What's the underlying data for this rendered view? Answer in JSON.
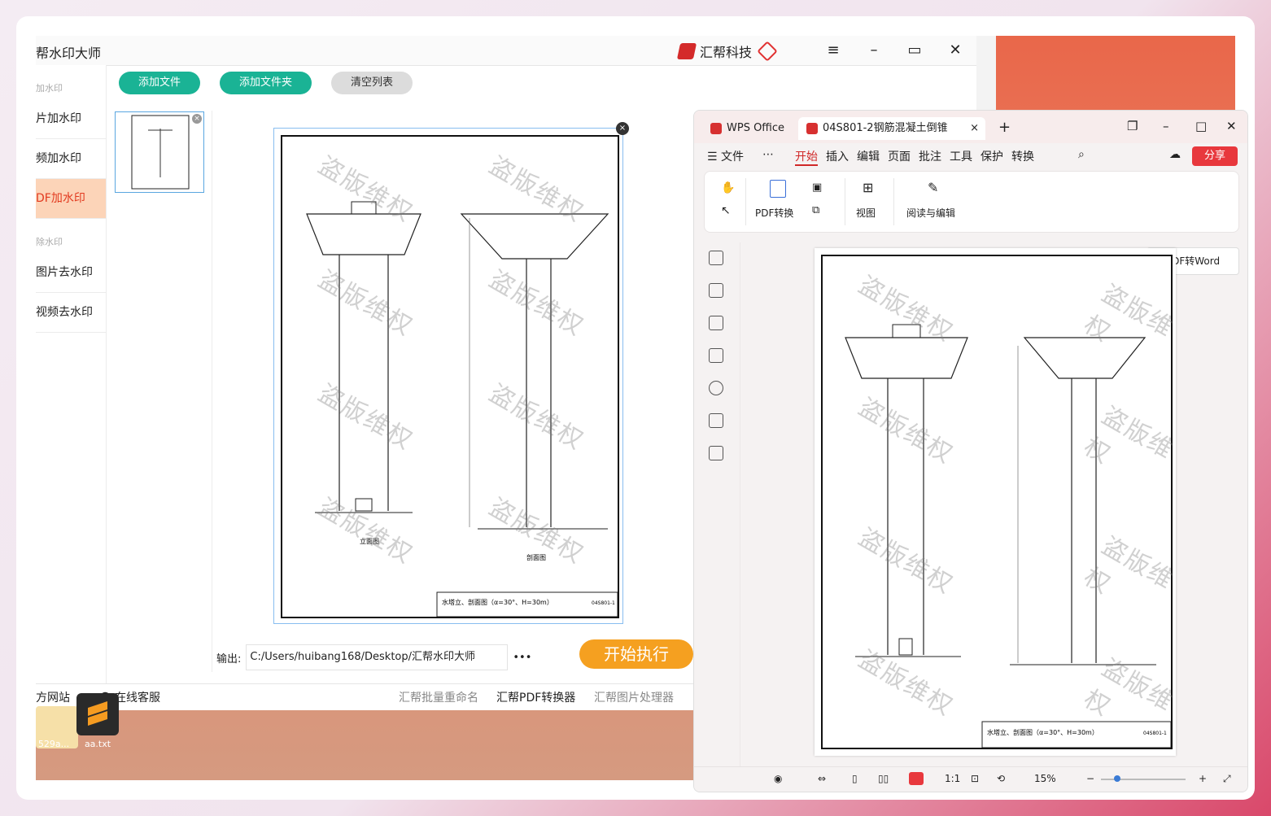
{
  "app": {
    "title": "帮水印大师",
    "brand": "汇帮科技",
    "sidebar": {
      "group1": "加水印",
      "items1": [
        "片加水印",
        "频加水印",
        "DF加水印"
      ],
      "group2": "除水印",
      "items2": [
        "图片去水印",
        "视频去水印"
      ]
    },
    "toolbar": {
      "add_file": "添加文件",
      "add_folder": "添加文件夹",
      "clear_list": "清空列表"
    },
    "output_label": "输出:",
    "output_path": "C:/Users/huibang168/Desktop/汇帮水印大师",
    "ellipsis": "•••",
    "start_button": "开始执行",
    "footer": {
      "website": "方网站",
      "support": "在线客服",
      "link1": "汇帮批量重命名",
      "link2": "汇帮PDF转换器",
      "link3": "汇帮图片处理器"
    },
    "watermark_text": "盗版维权",
    "drawing": {
      "title_block": "水塔立、剖面图（α=30°、H=30m）",
      "drawing_no": "04S801-1",
      "left_caption": "立面图",
      "right_caption": "剖面图"
    }
  },
  "desktop": {
    "icon1_label": "529a...",
    "icon2_label": "aa.txt"
  },
  "wps": {
    "tab_home": "WPS Office",
    "tab_doc": "04S801-2钢筋混凝土倒锥",
    "menu": [
      "文件",
      "开始",
      "插入",
      "编辑",
      "页面",
      "批注",
      "工具",
      "保护",
      "转换"
    ],
    "share": "分享",
    "ribbon": {
      "pdf_convert": "PDF转换",
      "view": "视图",
      "read_edit": "阅读与编辑"
    },
    "pdf_to_word": "PDF转Word",
    "zoom": "15%",
    "active_menu": "开始"
  }
}
